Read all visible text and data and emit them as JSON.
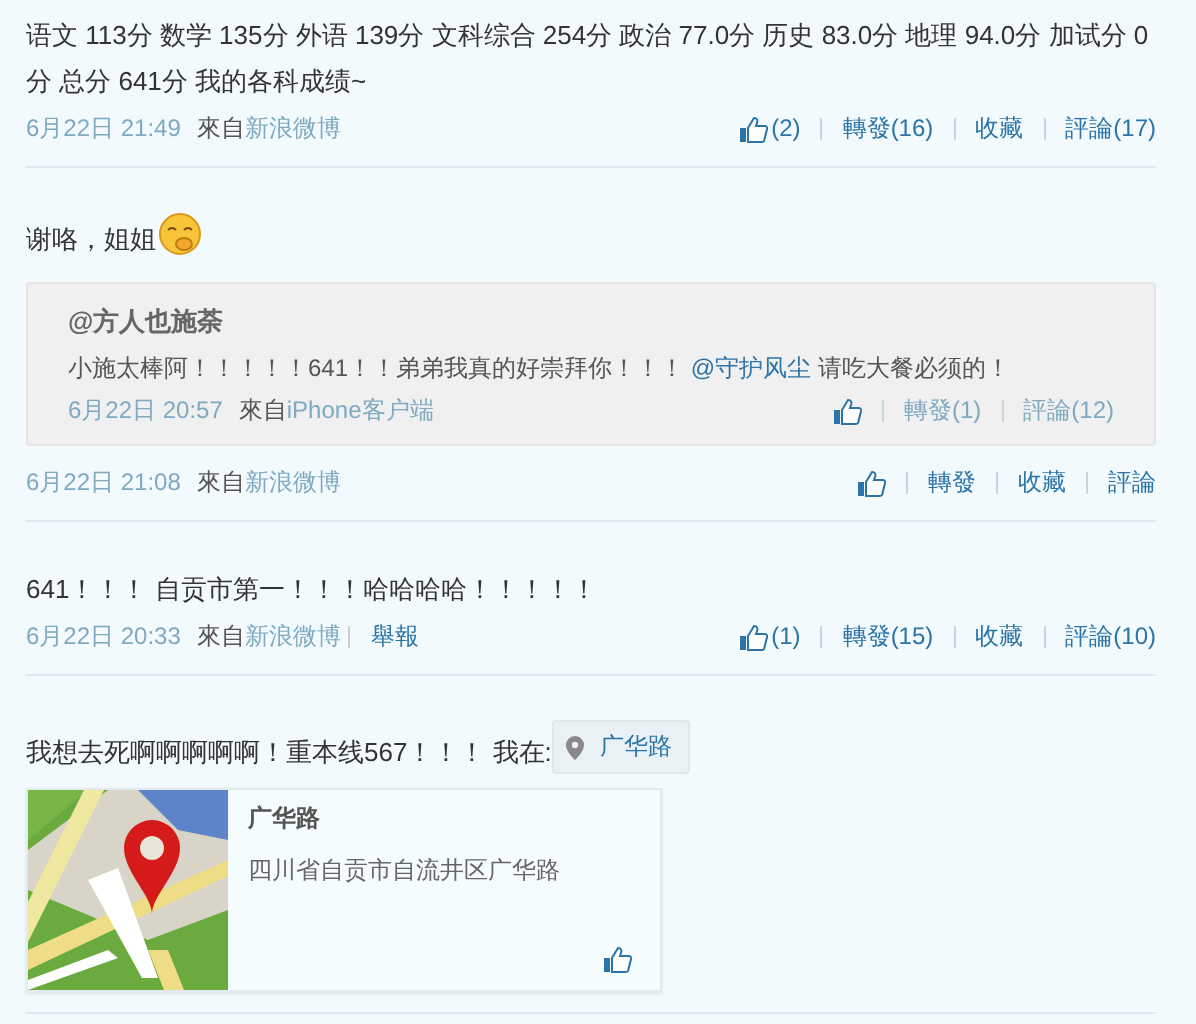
{
  "posts": [
    {
      "text": "语文 113分 数学 135分 外语 139分 文科综合 254分 政治 77.0分 历史 83.0分 地理 94.0分 加试分 0分 总分 641分 我的各科成绩~",
      "emoticon": false,
      "meta": {
        "date": "6月22日 21:49",
        "from": "來自",
        "source": "新浪微博"
      },
      "actions": [
        {
          "kind": "like",
          "count": "(2)"
        },
        {
          "kind": "link",
          "label": "轉發(16)"
        },
        {
          "kind": "link",
          "label": "收藏"
        },
        {
          "kind": "link",
          "label": "評論(17)"
        }
      ]
    },
    {
      "text": "谢咯，姐姐",
      "emoticon": true,
      "quote": {
        "author": "@方人也施荼",
        "parts": [
          {
            "kind": "plain",
            "text": "小施太棒阿！！！！！641！！弟弟我真的好崇拜你！！！ "
          },
          {
            "kind": "mention",
            "text": "@守护风尘"
          },
          {
            "kind": "plain",
            "text": " 请吃大餐必须的！"
          }
        ],
        "meta": {
          "date": "6月22日 20:57",
          "from": "來自",
          "source": "iPhone客户端"
        },
        "actions": [
          {
            "kind": "like"
          },
          {
            "kind": "link",
            "label": "轉發(1)"
          },
          {
            "kind": "link",
            "label": "評論(12)"
          }
        ]
      },
      "meta": {
        "date": "6月22日 21:08",
        "from": "來自",
        "source": "新浪微博"
      },
      "actions": [
        {
          "kind": "like"
        },
        {
          "kind": "link",
          "label": "轉發"
        },
        {
          "kind": "link",
          "label": "收藏"
        },
        {
          "kind": "link",
          "label": "評論"
        }
      ]
    },
    {
      "text": "641！！！ 自贡市第一！！！哈哈哈哈！！！！！",
      "emoticon": false,
      "meta": {
        "date": "6月22日 20:33",
        "from": "來自",
        "source": "新浪微博",
        "report": "舉報"
      },
      "actions": [
        {
          "kind": "like",
          "count": "(1)"
        },
        {
          "kind": "link",
          "label": "轉發(15)"
        },
        {
          "kind": "link",
          "label": "收藏"
        },
        {
          "kind": "link",
          "label": "評論(10)"
        }
      ]
    },
    {
      "text": "我想去死啊啊啊啊啊！重本线567！！！ 我在:",
      "emoticon": false,
      "location": {
        "tag": "广华路",
        "title": "广华路",
        "address": "四川省自贡市自流井区广华路"
      }
    }
  ]
}
